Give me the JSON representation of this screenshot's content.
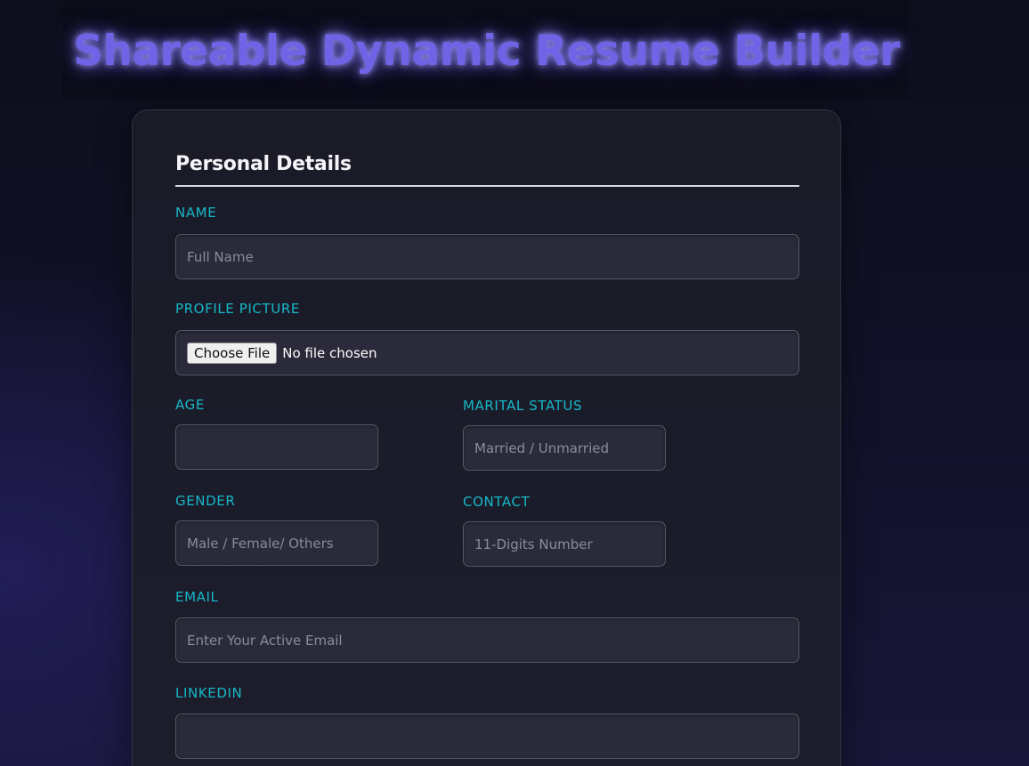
{
  "header": {
    "title": "Shareable Dynamic Resume Builder"
  },
  "form": {
    "section_title": "Personal Details",
    "name": {
      "label": "NAME",
      "placeholder": "Full Name"
    },
    "profile_picture": {
      "label": "PROFILE PICTURE",
      "button_label": "Choose File",
      "status": "No file chosen"
    },
    "age": {
      "label": "AGE",
      "placeholder": ""
    },
    "marital_status": {
      "label": "MARITAL STATUS",
      "placeholder": "Married / Unmarried"
    },
    "gender": {
      "label": "GENDER",
      "placeholder": "Male / Female/ Others"
    },
    "contact": {
      "label": "CONTACT",
      "placeholder": "11-Digits Number"
    },
    "email": {
      "label": "EMAIL",
      "placeholder": "Enter Your Active Email"
    },
    "linkedin": {
      "label": "LINKEDIN",
      "placeholder": ""
    }
  },
  "colors": {
    "accent_title": "#6f64e6",
    "label": "#17b8c9",
    "card_bg": "#1a1b27",
    "input_bg": "#2a2a3a"
  }
}
